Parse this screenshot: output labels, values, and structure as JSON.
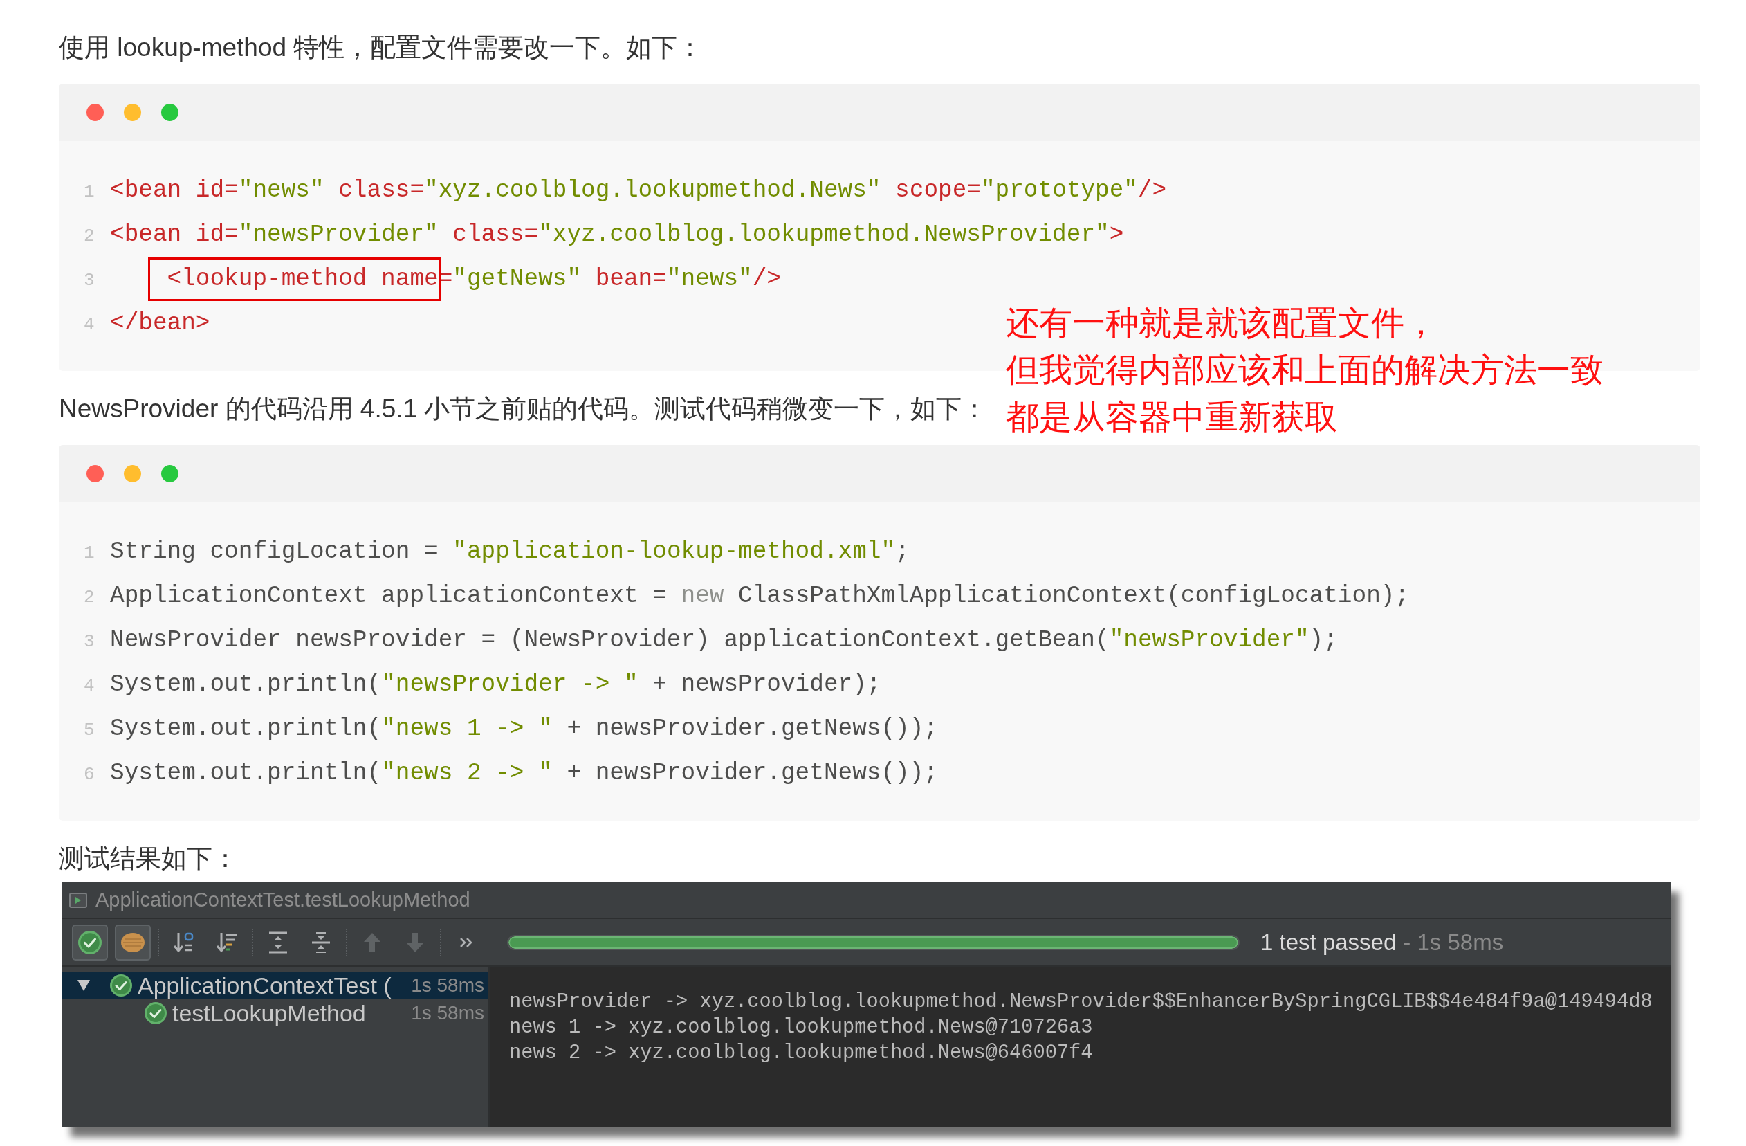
{
  "content": [
    {
      "kind": "paragraph",
      "text": "使用 lookup-method 特性，配置文件需要改一下。如下："
    },
    {
      "kind": "code",
      "lines": [
        {
          "number": "1",
          "tokens": [
            {
              "kind": "tag",
              "text": "<bean id="
            },
            {
              "kind": "string",
              "text": "\"news\""
            },
            {
              "kind": "tag",
              "text": " class="
            },
            {
              "kind": "string",
              "text": "\"xyz.coolblog.lookupmethod.News\""
            },
            {
              "kind": "tag",
              "text": " scope="
            },
            {
              "kind": "string",
              "text": "\"prototype\""
            },
            {
              "kind": "tag",
              "text": "/>"
            }
          ]
        },
        {
          "number": "2",
          "tokens": [
            {
              "kind": "tag",
              "text": "<bean id="
            },
            {
              "kind": "string",
              "text": "\"newsProvider\""
            },
            {
              "kind": "tag",
              "text": " class="
            },
            {
              "kind": "string",
              "text": "\"xyz.coolblog.lookupmethod.NewsProvider\""
            },
            {
              "kind": "tag",
              "text": ">"
            }
          ]
        },
        {
          "number": "3",
          "tokens": [
            {
              "kind": "tag",
              "text": "    <lookup-method name",
              "boxed": true
            },
            {
              "kind": "tag",
              "text": "=",
              "boxed": false
            },
            {
              "kind": "string",
              "text": "\"getNews\"",
              "boxed": false
            },
            {
              "kind": "tag",
              "text": " bean=",
              "boxed": false
            },
            {
              "kind": "string",
              "text": "\"news\"",
              "boxed": false
            },
            {
              "kind": "tag",
              "text": "/>",
              "boxed": false
            }
          ]
        },
        {
          "number": "4",
          "tokens": [
            {
              "kind": "tag",
              "text": "</bean>"
            }
          ]
        }
      ]
    },
    {
      "kind": "paragraph",
      "text": "NewsProvider 的代码沿用 4.5.1 小节之前贴的代码。测试代码稍微变一下，如下："
    },
    {
      "kind": "code",
      "lines": [
        {
          "number": "1",
          "tokens": [
            {
              "kind": "plain",
              "text": "String configLocation = "
            },
            {
              "kind": "string",
              "text": "\"application-lookup-method.xml\""
            },
            {
              "kind": "plain",
              "text": ";"
            }
          ]
        },
        {
          "number": "2",
          "tokens": [
            {
              "kind": "plain",
              "text": "ApplicationContext applicationContext = "
            },
            {
              "kind": "keyword",
              "text": "new"
            },
            {
              "kind": "plain",
              "text": " ClassPathXmlApplicationContext(configLocation);"
            }
          ]
        },
        {
          "number": "3",
          "tokens": [
            {
              "kind": "plain",
              "text": "NewsProvider newsProvider = (NewsProvider) applicationContext.getBean("
            },
            {
              "kind": "string",
              "text": "\"newsProvider\""
            },
            {
              "kind": "plain",
              "text": ");"
            }
          ]
        },
        {
          "number": "4",
          "tokens": [
            {
              "kind": "plain",
              "text": "System.out.println("
            },
            {
              "kind": "string",
              "text": "\"newsProvider -> \""
            },
            {
              "kind": "plain",
              "text": " + newsProvider);"
            }
          ]
        },
        {
          "number": "5",
          "tokens": [
            {
              "kind": "plain",
              "text": "System.out.println("
            },
            {
              "kind": "string",
              "text": "\"news 1 -> \""
            },
            {
              "kind": "plain",
              "text": " + newsProvider.getNews());"
            }
          ]
        },
        {
          "number": "6",
          "tokens": [
            {
              "kind": "plain",
              "text": "System.out.println("
            },
            {
              "kind": "string",
              "text": "\"news 2 -> \""
            },
            {
              "kind": "plain",
              "text": " + newsProvider.getNews());"
            }
          ]
        }
      ]
    },
    {
      "kind": "paragraph",
      "text": "测试结果如下："
    },
    {
      "kind": "test_runner",
      "title": "ApplicationContextTest.testLookupMethod",
      "toolbar": [
        {
          "kind": "show_passed",
          "pressed": true,
          "disabled": false
        },
        {
          "kind": "show_ignored",
          "pressed": true,
          "disabled": false
        },
        {
          "kind": "sort_alpha",
          "pressed": false,
          "disabled": false
        },
        {
          "kind": "sort_duration",
          "pressed": false,
          "disabled": false
        },
        {
          "kind": "expand_all",
          "pressed": false,
          "disabled": false
        },
        {
          "kind": "collapse_all",
          "pressed": false,
          "disabled": false
        },
        {
          "kind": "previous",
          "pressed": false,
          "disabled": true
        },
        {
          "kind": "next",
          "pressed": false,
          "disabled": true
        },
        {
          "kind": "more",
          "pressed": false,
          "disabled": false
        }
      ],
      "progress": {
        "level": 1,
        "status": "1 test passed",
        "duration": "- 1s 58ms"
      },
      "tree": [
        {
          "kind": "passed",
          "label": "ApplicationContextTest (",
          "time": "1s 58ms",
          "selected": true,
          "expanded": true,
          "children": [
            {
              "kind": "passed",
              "label": "testLookupMethod",
              "time": "1s 58ms",
              "selected": false
            }
          ]
        }
      ],
      "console": [
        "newsProvider -> xyz.coolblog.lookupmethod.NewsProvider$$EnhancerBySpringCGLIB$$4e484f9a@149494d8",
        "news 1 -> xyz.coolblog.lookupmethod.News@710726a3",
        "news 2 -> xyz.coolblog.lookupmethod.News@646007f4"
      ]
    }
  ],
  "annotation": {
    "lines": [
      "还有一种就是就该配置文件，",
      "但我觉得内部应该和上面的解决方法一致",
      "都是从容器中重新获取"
    ]
  }
}
